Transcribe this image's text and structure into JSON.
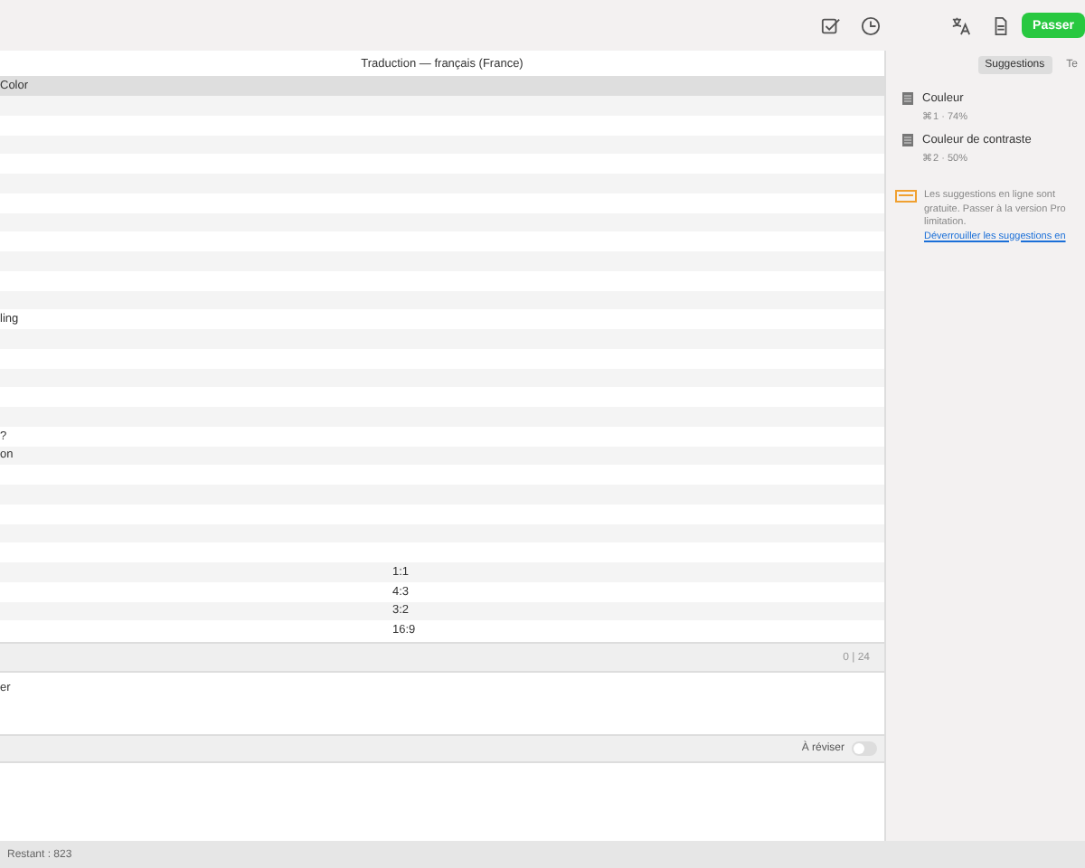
{
  "toolbar": {
    "primary_button": "Passer"
  },
  "editor": {
    "title": "Traduction — français (France)",
    "column_header": "Color",
    "rows": [
      {
        "source": "",
        "target": ""
      },
      {
        "source": "",
        "target": ""
      },
      {
        "source": "",
        "target": ""
      },
      {
        "source": "",
        "target": ""
      },
      {
        "source": "",
        "target": ""
      },
      {
        "source": "",
        "target": ""
      },
      {
        "source": "",
        "target": ""
      },
      {
        "source": "",
        "target": ""
      },
      {
        "source": "",
        "target": ""
      },
      {
        "source": "",
        "target": ""
      },
      {
        "source": "",
        "target": ""
      },
      {
        "source": "ling",
        "target": ""
      },
      {
        "source": "",
        "target": ""
      },
      {
        "source": "",
        "target": ""
      },
      {
        "source": "",
        "target": ""
      },
      {
        "source": "",
        "target": ""
      },
      {
        "source": "",
        "target": ""
      },
      {
        "source": "?",
        "target": ""
      },
      {
        "source": "on",
        "target": ""
      },
      {
        "source": "",
        "target": ""
      },
      {
        "source": "",
        "target": ""
      },
      {
        "source": "",
        "target": ""
      },
      {
        "source": "",
        "target": ""
      },
      {
        "source": "",
        "target": ""
      },
      {
        "source": "",
        "target": "1:1"
      },
      {
        "source": "",
        "target": "4:3"
      },
      {
        "source": "",
        "target": "3:2"
      },
      {
        "source": "",
        "target": "16:9"
      }
    ],
    "counter": "0 | 24",
    "source_text": "er",
    "review_label": "À réviser",
    "review_on": false,
    "status": "Restant : 823"
  },
  "sidebar": {
    "tabs": [
      {
        "label": "Suggestions",
        "selected": true
      },
      {
        "label": "Te",
        "selected": false
      }
    ],
    "suggestions": [
      {
        "text": "Couleur",
        "meta": "⌘1 · 74%"
      },
      {
        "text": "Couleur de contraste",
        "meta": "⌘2 · 50%"
      }
    ],
    "notice_lines": [
      "Les suggestions en ligne sont",
      "gratuite. Passer à la version Pro",
      "limitation."
    ],
    "notice_link": "Déverrouiller les suggestions en"
  }
}
